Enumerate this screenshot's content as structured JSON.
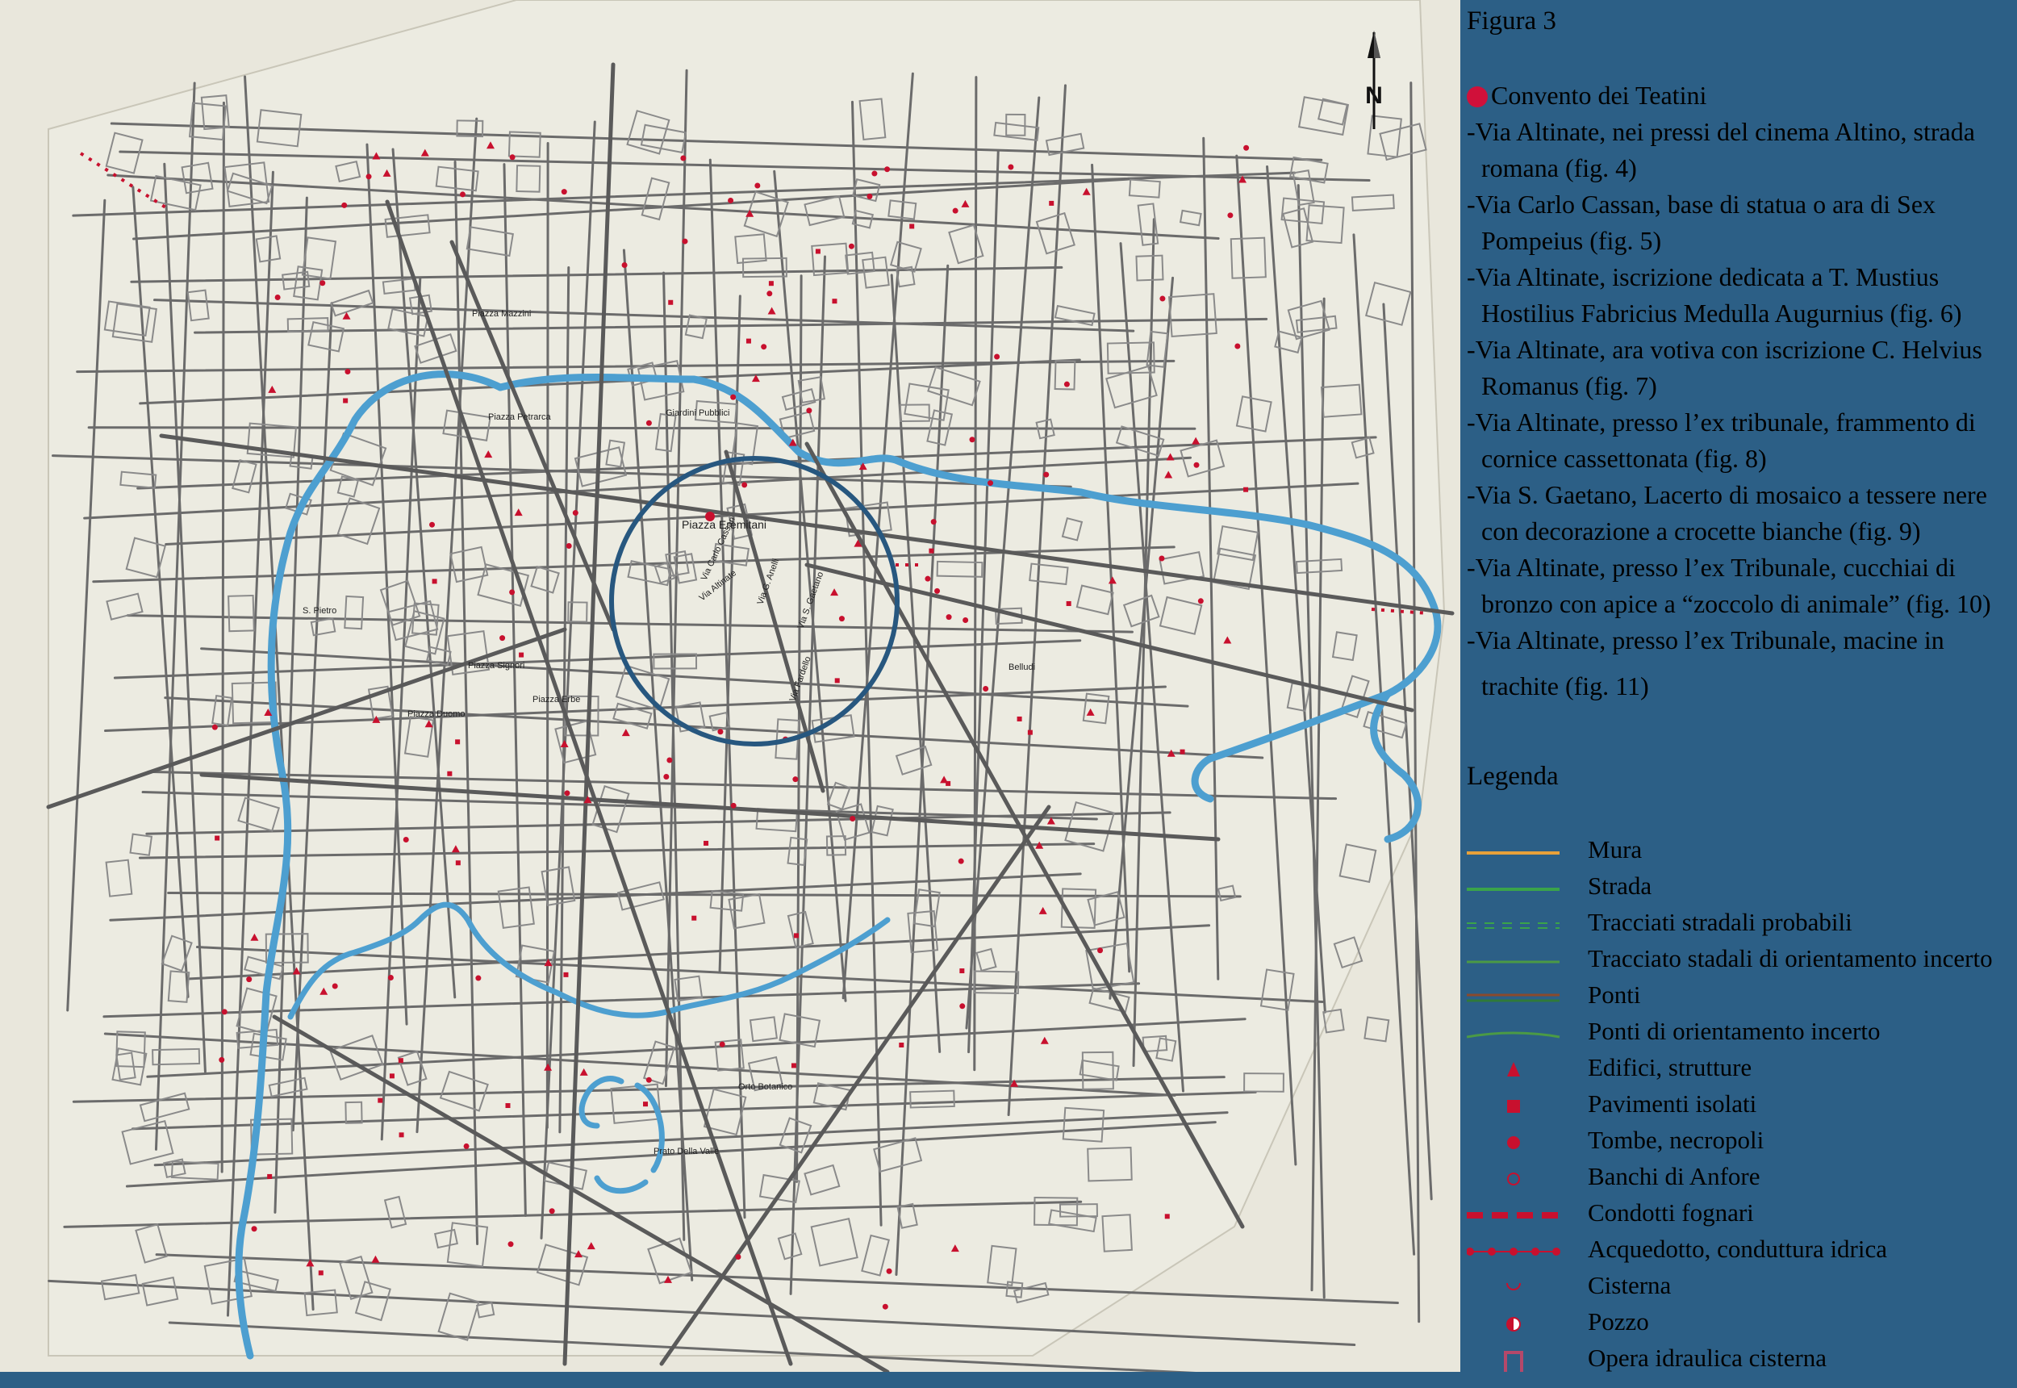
{
  "sidebar": {
    "figure_title": "Figura 3",
    "items": [
      {
        "line1": "Convento dei Teatini"
      },
      {
        "line1": "-Via Altinate, nei pressi del cinema Altino, strada",
        "line2": "romana (fig. 4)"
      },
      {
        "line1": "-Via Carlo Cassan, base di statua o ara di Sex",
        "line2": "Pompeius (fig. 5)"
      },
      {
        "line1": "-Via Altinate, iscrizione dedicata a T. Mustius",
        "line2": "Hostilius Fabricius Medulla Augurnius (fig. 6)"
      },
      {
        "line1": "-Via Altinate, ara votiva con iscrizione C. Helvius",
        "line2": "Romanus (fig. 7)"
      },
      {
        "line1": "-Via Altinate, presso l’ex tribunale, frammento di",
        "line2": "cornice cassettonata (fig. 8)"
      },
      {
        "line1": "-Via S. Gaetano, Lacerto di mosaico a tessere nere",
        "line2": "con decorazione a crocette bianche (fig. 9)"
      },
      {
        "line1": "-Via Altinate, presso l’ex Tribunale, cucchiai di",
        "line2": "bronzo con apice a “zoccolo di animale” (fig. 10)"
      },
      {
        "line1": "-Via Altinate, presso l’ex Tribunale, macine in",
        "line2": "trachite (fig. 11)"
      }
    ]
  },
  "legend": {
    "title": "Legenda",
    "entries": [
      {
        "label": "Mura",
        "symbol": "line-orange",
        "color": "#e7a13a"
      },
      {
        "label": "Strada",
        "symbol": "line-green",
        "color": "#3aa34a"
      },
      {
        "label": "Tracciati stradali probabili",
        "symbol": "dashed-green",
        "color": "#3aa34a"
      },
      {
        "label": "Tracciato stadali di orientamento incerto",
        "symbol": "line-green-thin",
        "color": "#4b9a45"
      },
      {
        "label": "Ponti",
        "symbol": "bridge",
        "color": "#8a4a2c"
      },
      {
        "label": "Ponti di orientamento incerto",
        "symbol": "bridge-uncertain",
        "color": "#4b9a45"
      },
      {
        "label": "Edifici, strutture",
        "symbol": "triangle",
        "color": "#c8102e"
      },
      {
        "label": "Pavimenti isolati",
        "symbol": "square",
        "color": "#c8102e"
      },
      {
        "label": "Tombe, necropoli",
        "symbol": "dot",
        "color": "#c8102e"
      },
      {
        "label": "Banchi di Anfore",
        "symbol": "ring",
        "color": "#c8102e"
      },
      {
        "label": "Condotti fognari",
        "symbol": "dashed-red",
        "color": "#c8102e"
      },
      {
        "label": "Acquedotto, conduttura idrica",
        "symbol": "dotted-red",
        "color": "#c8102e"
      },
      {
        "label": "Cisterna",
        "symbol": "arc",
        "color": "#c8102e"
      },
      {
        "label": "Pozzo",
        "symbol": "half-dot",
        "color": "#c8102e"
      },
      {
        "label": "Opera idraulica cisterna",
        "symbol": "gate",
        "color": "#c8102e"
      }
    ]
  },
  "map": {
    "north_label": "N",
    "labels": {
      "piazza_mazzini": "Piazza Mazzini",
      "piazza_eremitani": "Piazza Eremitani",
      "via_altinate": "Via Altinate",
      "via_g_anelli": "Via G. Anelli",
      "via_carlo_cassan": "Via Carlo Cassan",
      "via_s_gaetano": "Via S. Gaetano",
      "via_fardello": "Via Fardello",
      "piazza_petrarca": "Piazza Petrarca",
      "giardini_pubblici": "Giardini Pubblici",
      "piazza_duomo": "Piazza Duomo",
      "piazza_signori": "Piazza Signori",
      "piazza_erbe": "Piazza Erbe",
      "prato_della_valle": "Prato Della Valle",
      "orto_botanico": "Orto Botanico",
      "s_pietro": "S. Pietro",
      "belludi": "Belludi"
    },
    "highlight_color": "#27577f",
    "water_color": "#4d9fd0",
    "finding_color": "#c8102e"
  }
}
